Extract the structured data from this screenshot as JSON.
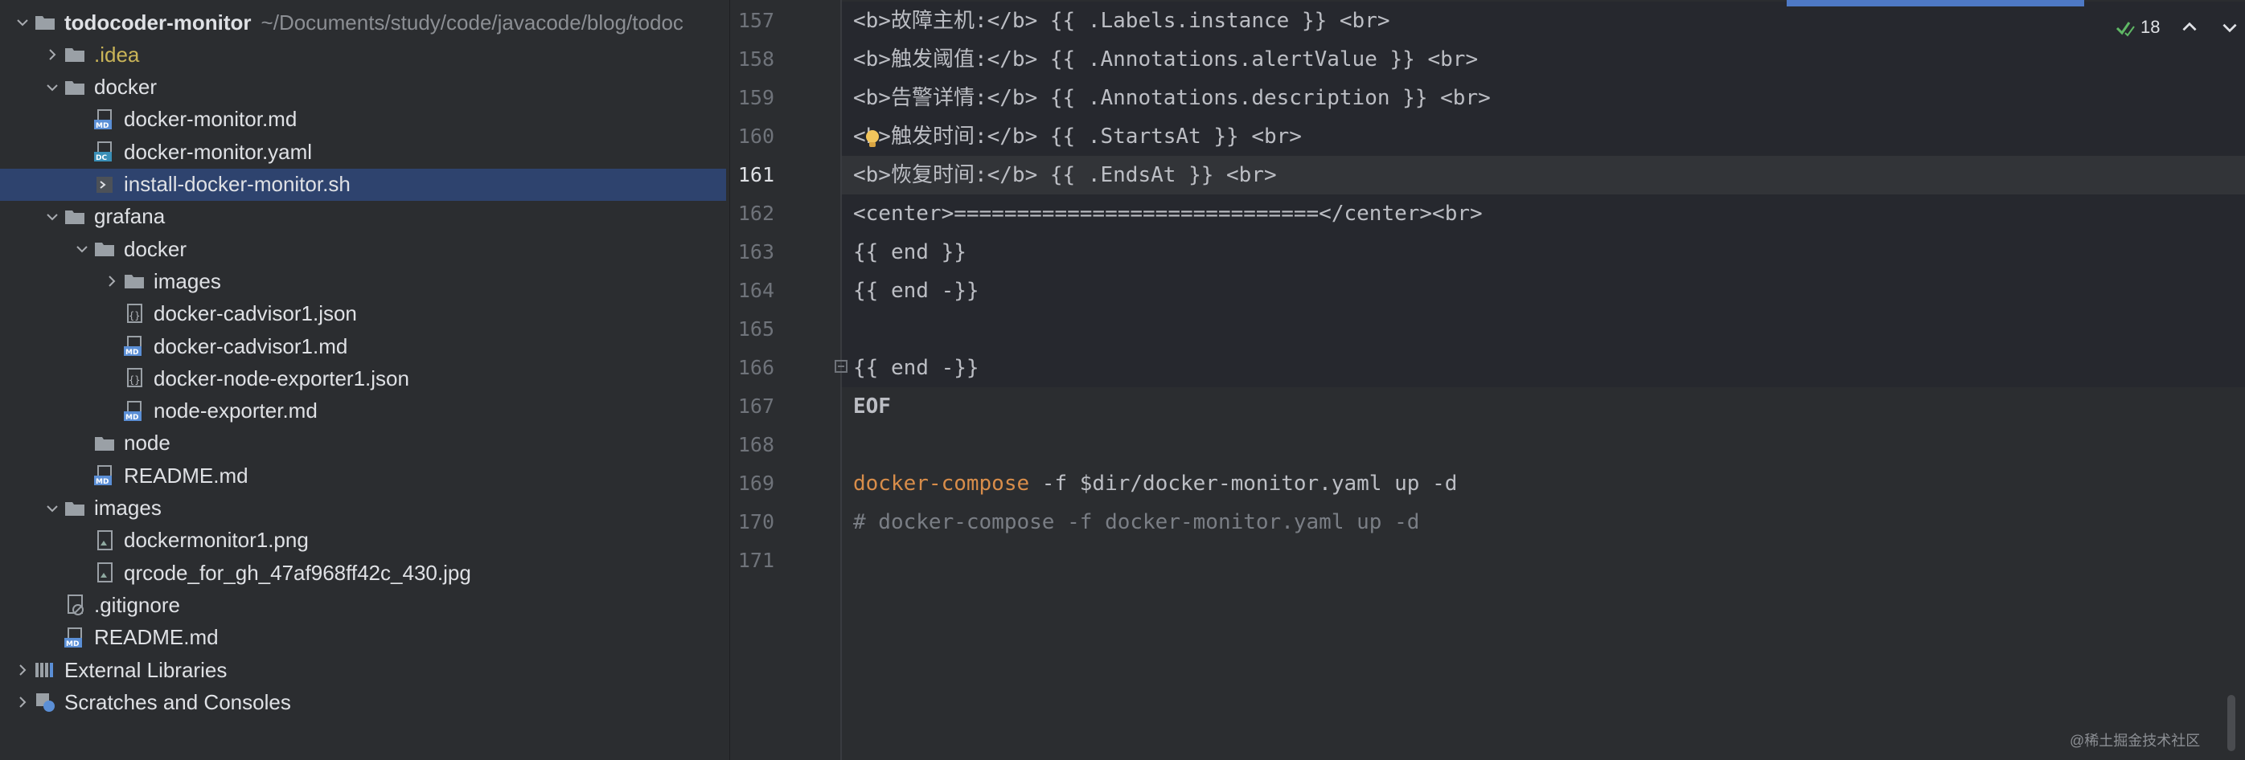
{
  "project": {
    "name": "todocoder-monitor",
    "path": "~/Documents/study/code/javacode/blog/todoc"
  },
  "tree": [
    {
      "label": "todocoder-monitor",
      "depth": 0,
      "chevron": "down",
      "icon": "folder-icon",
      "bold": true
    },
    {
      "label": ".idea",
      "depth": 1,
      "chevron": "right",
      "icon": "folder-icon",
      "ignored": true
    },
    {
      "label": "docker",
      "depth": 1,
      "chevron": "down",
      "icon": "folder-icon"
    },
    {
      "label": "docker-monitor.md",
      "depth": 2,
      "chevron": "none",
      "icon": "markdown-file-icon"
    },
    {
      "label": "docker-monitor.yaml",
      "depth": 2,
      "chevron": "none",
      "icon": "docker-compose-file-icon"
    },
    {
      "label": "install-docker-monitor.sh",
      "depth": 2,
      "chevron": "none",
      "icon": "shell-script-icon",
      "selected": true
    },
    {
      "label": "grafana",
      "depth": 1,
      "chevron": "down",
      "icon": "folder-icon"
    },
    {
      "label": "docker",
      "depth": 2,
      "chevron": "down",
      "icon": "folder-icon"
    },
    {
      "label": "images",
      "depth": 3,
      "chevron": "right",
      "icon": "folder-icon"
    },
    {
      "label": "docker-cadvisor1.json",
      "depth": 3,
      "chevron": "none",
      "icon": "json-file-icon"
    },
    {
      "label": "docker-cadvisor1.md",
      "depth": 3,
      "chevron": "none",
      "icon": "markdown-file-icon"
    },
    {
      "label": "docker-node-exporter1.json",
      "depth": 3,
      "chevron": "none",
      "icon": "json-file-icon"
    },
    {
      "label": "node-exporter.md",
      "depth": 3,
      "chevron": "none",
      "icon": "markdown-file-icon"
    },
    {
      "label": "node",
      "depth": 2,
      "chevron": "none",
      "icon": "folder-icon"
    },
    {
      "label": "README.md",
      "depth": 2,
      "chevron": "none",
      "icon": "markdown-file-icon"
    },
    {
      "label": "images",
      "depth": 1,
      "chevron": "down",
      "icon": "folder-icon"
    },
    {
      "label": "dockermonitor1.png",
      "depth": 2,
      "chevron": "none",
      "icon": "image-file-icon"
    },
    {
      "label": "qrcode_for_gh_47af968ff42c_430.jpg",
      "depth": 2,
      "chevron": "none",
      "icon": "image-file-icon"
    },
    {
      "label": ".gitignore",
      "depth": 1,
      "chevron": "none",
      "icon": "gitignore-file-icon"
    },
    {
      "label": "README.md",
      "depth": 1,
      "chevron": "none",
      "icon": "markdown-file-icon"
    },
    {
      "label": "External Libraries",
      "depth": 0,
      "chevron": "right",
      "icon": "libraries-icon"
    },
    {
      "label": "Scratches and Consoles",
      "depth": 0,
      "chevron": "right",
      "icon": "scratches-icon"
    }
  ],
  "editor": {
    "inspection_count": "18",
    "current_line": 161,
    "lines": [
      {
        "num": "157",
        "segments": [
          {
            "t": "<b>故障主机:</b> {{ .Labels.instance }} <br>"
          }
        ]
      },
      {
        "num": "158",
        "segments": [
          {
            "t": "<b>触发阈值:</b> {{ .Annotations.alertValue }} <br>"
          }
        ]
      },
      {
        "num": "159",
        "segments": [
          {
            "t": "<b>告警详情:</b> {{ .Annotations.description }} <br>"
          }
        ]
      },
      {
        "num": "160",
        "segments": [
          {
            "t": "<b>触发时间:</b> {{ .StartsAt }} <br>"
          }
        ]
      },
      {
        "num": "161",
        "segments": [
          {
            "t": "<b>恢复时间:</b> {{ .EndsAt }} <br>"
          }
        ]
      },
      {
        "num": "162",
        "segments": [
          {
            "t": "<center>=============================</center><br>"
          }
        ]
      },
      {
        "num": "163",
        "segments": [
          {
            "t": "{{ end }}"
          }
        ]
      },
      {
        "num": "164",
        "segments": [
          {
            "t": "{{ end -}}"
          }
        ]
      },
      {
        "num": "165",
        "segments": [
          {
            "t": ""
          }
        ]
      },
      {
        "num": "166",
        "segments": [
          {
            "t": "{{ end -}}"
          }
        ]
      },
      {
        "num": "167",
        "segments": [
          {
            "t": "EOF",
            "c": "bold"
          }
        ]
      },
      {
        "num": "168",
        "segments": [
          {
            "t": ""
          }
        ]
      },
      {
        "num": "169",
        "segments": [
          {
            "t": "docker-compose",
            "c": "kw"
          },
          {
            "t": " -f $dir/docker-monitor.yaml up -d"
          }
        ]
      },
      {
        "num": "170",
        "segments": [
          {
            "t": "# docker-compose -f docker-monitor.yaml up -d",
            "c": "comment"
          }
        ]
      },
      {
        "num": "171",
        "segments": [
          {
            "t": ""
          }
        ]
      }
    ]
  },
  "watermark": "@稀土掘金技术社区",
  "colors": {
    "background": "#2b2d30",
    "selection": "#2e436e",
    "keyword": "#d88d4a",
    "comment": "#7a7e85",
    "ignored_file": "#c9b458"
  }
}
